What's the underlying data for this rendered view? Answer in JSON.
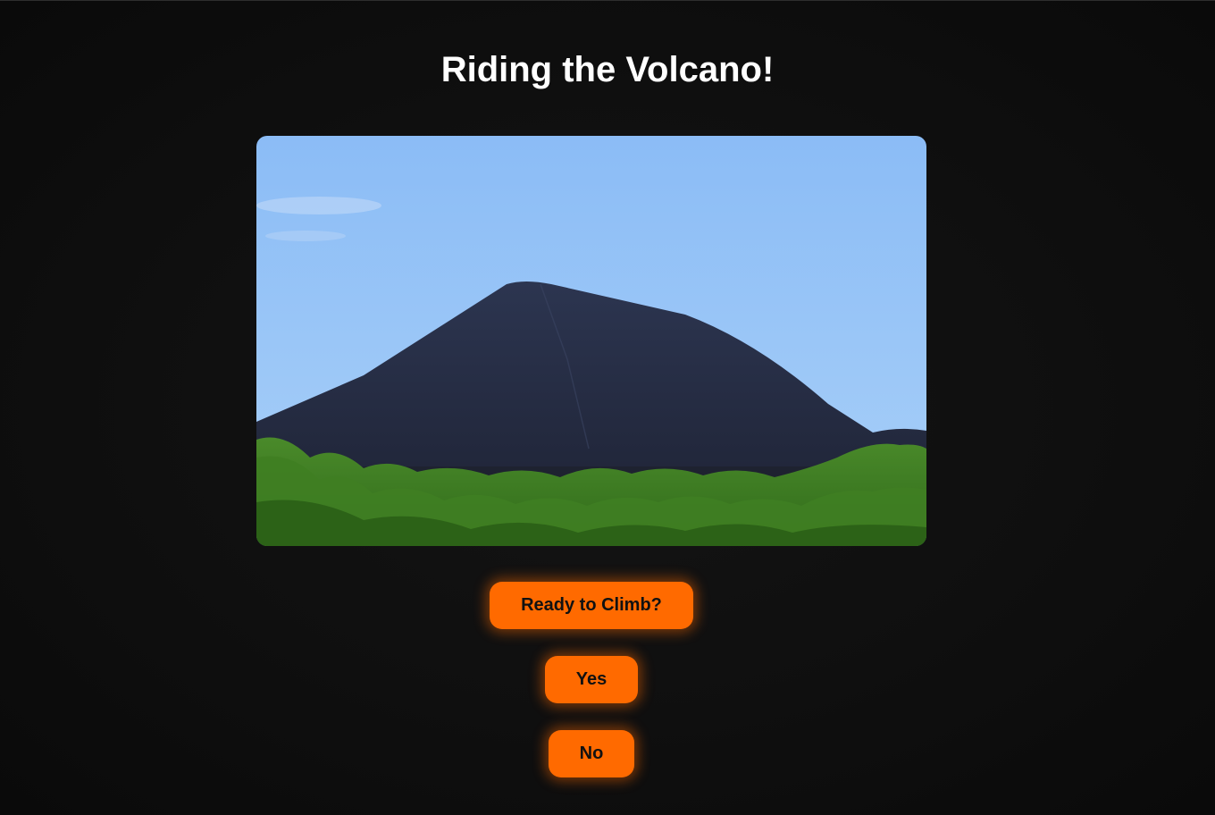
{
  "page": {
    "title": "Riding the Volcano!"
  },
  "hero_image": {
    "subject": "volcano-photo"
  },
  "buttons": {
    "ready_label": "Ready to Climb?",
    "yes_label": "Yes",
    "no_label": "No"
  },
  "colors": {
    "background": "#0f0f0f",
    "accent": "#ff6a00",
    "title_text": "#ffffff",
    "button_text": "#111111"
  }
}
